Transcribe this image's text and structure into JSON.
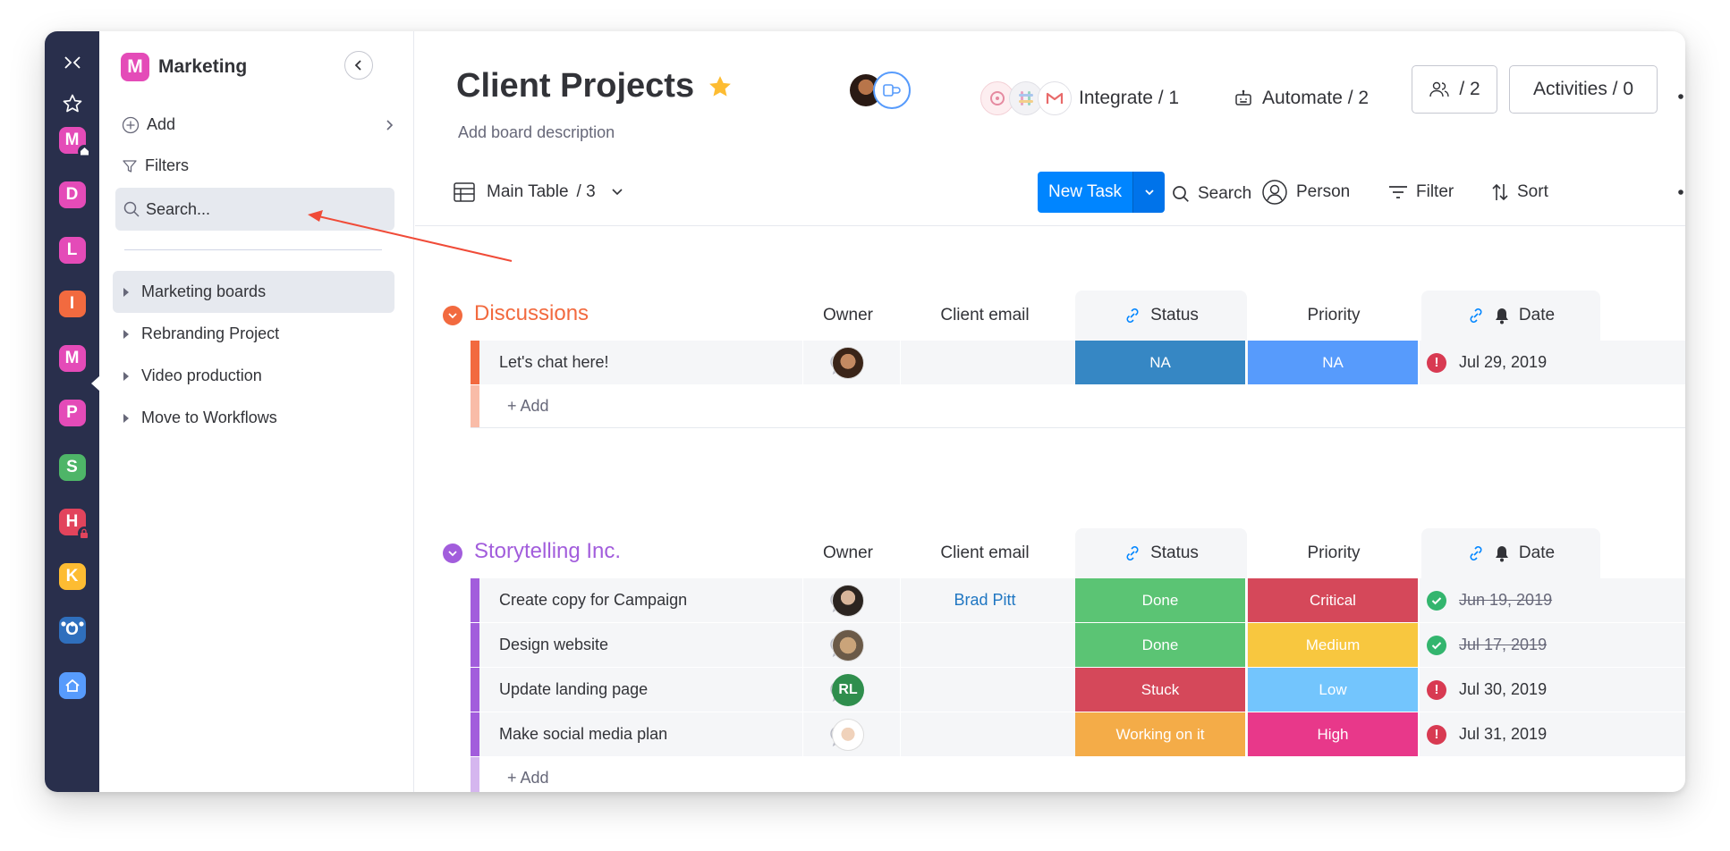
{
  "rail": {
    "workspaces": [
      {
        "letter": "M",
        "color": "#e44bb8",
        "badge": "home"
      },
      {
        "letter": "D",
        "color": "#e44bb8"
      },
      {
        "letter": "L",
        "color": "#e44bb8"
      },
      {
        "letter": "I",
        "color": "#f26a3f"
      },
      {
        "letter": "M",
        "color": "#e44bb8",
        "active": true
      },
      {
        "letter": "P",
        "color": "#e44bb8"
      },
      {
        "letter": "S",
        "color": "#4eb568"
      },
      {
        "letter": "H",
        "color": "#e2445c",
        "badge": "lock"
      },
      {
        "letter": "K",
        "color": "#fdbc32"
      },
      {
        "letter": "O",
        "color": "#2f6fbd"
      }
    ]
  },
  "sidebar": {
    "workspace_letter": "M",
    "workspace_name": "Marketing",
    "add_label": "Add",
    "filters_label": "Filters",
    "search_placeholder": "Search...",
    "boards": [
      "Marketing boards",
      "Rebranding Project",
      "Video production",
      "Move to Workflows"
    ]
  },
  "board": {
    "title": "Client Projects",
    "description": "Add board description",
    "integrate_label": "Integrate / 1",
    "automate_label": "Automate / 2",
    "members_label": "/ 2",
    "activities_label": "Activities / 0"
  },
  "toolbar": {
    "view_label": "Main Table",
    "view_count": "/ 3",
    "new_task": "New Task",
    "search": "Search",
    "person": "Person",
    "filter": "Filter",
    "sort": "Sort"
  },
  "columns": {
    "owner": "Owner",
    "client_email": "Client email",
    "status": "Status",
    "priority": "Priority",
    "date": "Date"
  },
  "groups": [
    {
      "name": "Discussions",
      "color": "#f26a3f",
      "add_label": "+ Add",
      "rows": [
        {
          "task": "Let's chat here!",
          "owner": "photo",
          "email": "",
          "status": "NA",
          "status_color": "#3687c4",
          "priority": "NA",
          "priority_color": "#579bfc",
          "date": "Jul 29, 2019",
          "date_state": "overdue"
        }
      ]
    },
    {
      "name": "Storytelling Inc.",
      "color": "#a25ddc",
      "add_label": "+ Add",
      "rows": [
        {
          "task": "Create copy for Campaign",
          "owner": "photo",
          "email": "Brad Pitt",
          "status": "Done",
          "status_color": "#5bc474",
          "priority": "Critical",
          "priority_color": "#d5485a",
          "date": "Jun 19, 2019",
          "date_state": "done"
        },
        {
          "task": "Design website",
          "owner": "photo",
          "email": "",
          "status": "Done",
          "status_color": "#5bc474",
          "priority": "Medium",
          "priority_color": "#f8c73f",
          "date": "Jul 17, 2019",
          "date_state": "done"
        },
        {
          "task": "Update landing page",
          "owner": "RL",
          "email": "",
          "status": "Stuck",
          "status_color": "#d5485a",
          "priority": "Low",
          "priority_color": "#73c5fd",
          "date": "Jul 30, 2019",
          "date_state": "overdue"
        },
        {
          "task": "Make social media plan",
          "owner": "photo",
          "email": "",
          "status": "Working on it",
          "status_color": "#f4ac48",
          "priority": "High",
          "priority_color": "#e8388a",
          "date": "Jul 31, 2019",
          "date_state": "overdue"
        }
      ]
    }
  ]
}
